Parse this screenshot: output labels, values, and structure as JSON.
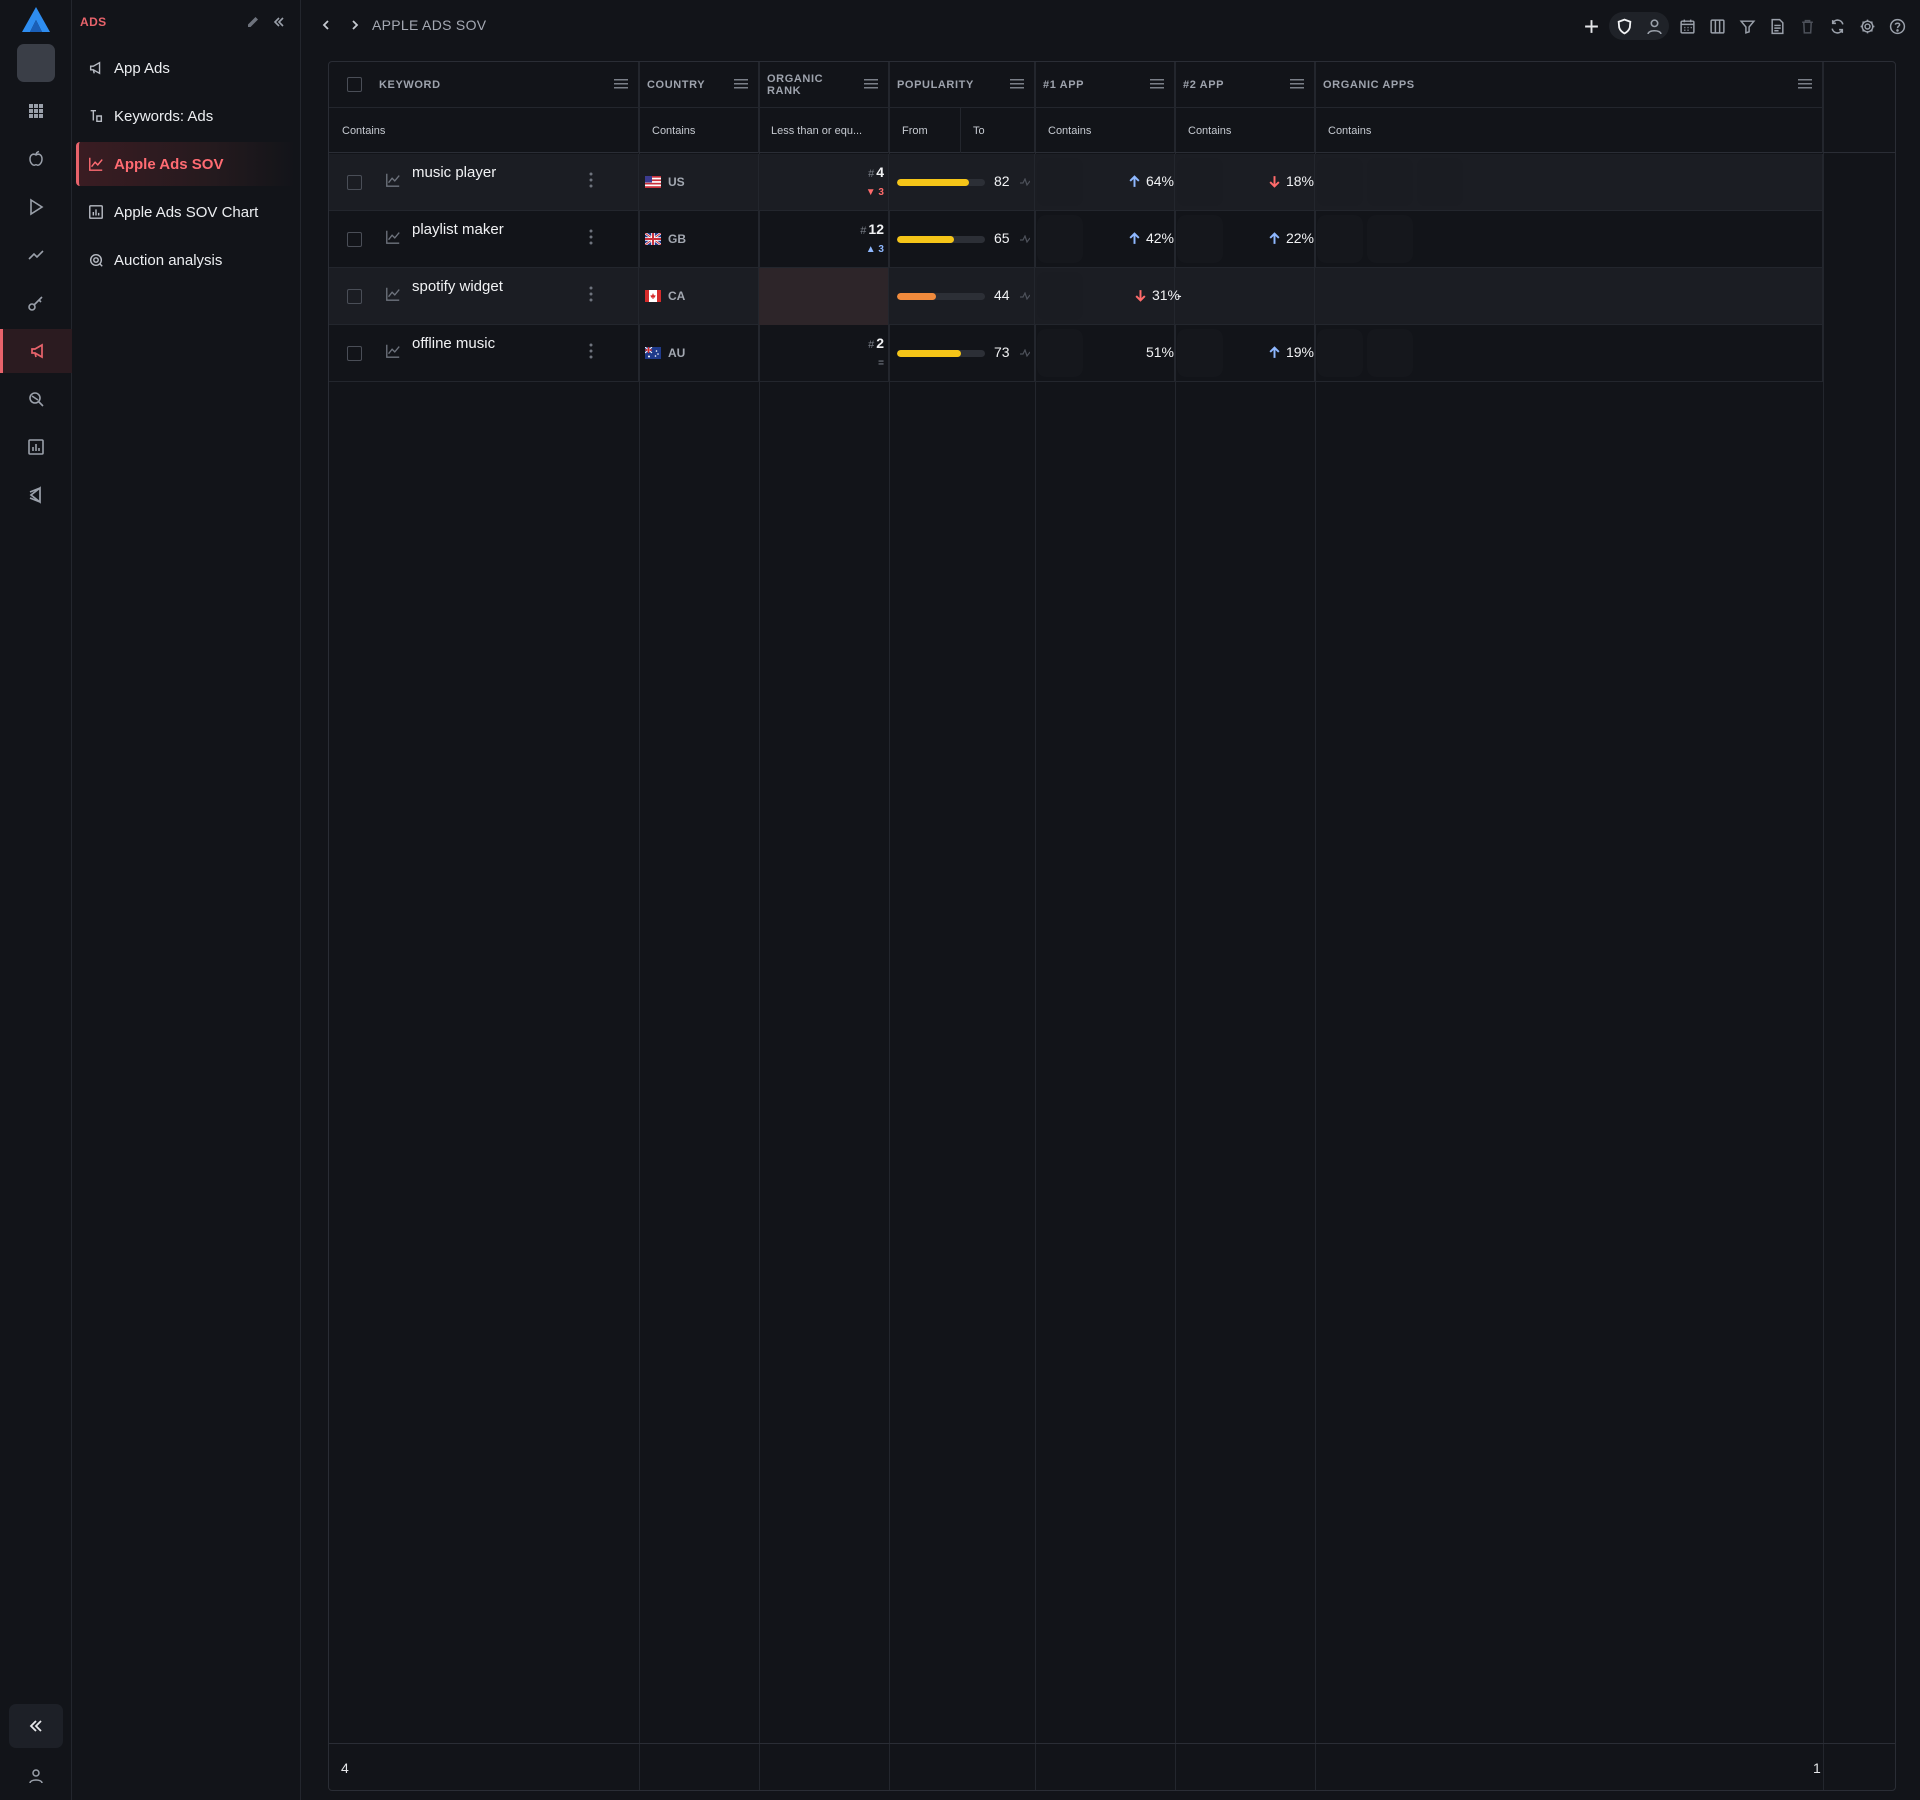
{
  "sidebar": {
    "title": "ADS",
    "items": [
      {
        "label": "App Ads",
        "icon": "megaphone-icon"
      },
      {
        "label": "Keywords: Ads",
        "icon": "keyword-ads-icon"
      },
      {
        "label": "Apple Ads SOV",
        "icon": "line-chart-icon",
        "active": true
      },
      {
        "label": "Apple Ads SOV Chart",
        "icon": "bar-chart-icon"
      },
      {
        "label": "Auction analysis",
        "icon": "auction-icon"
      }
    ]
  },
  "breadcrumb": "APPLE ADS SOV",
  "columns": {
    "keyword": "KEYWORD",
    "country": "COUNTRY",
    "organic_rank": "ORGANIC RANK",
    "popularity": "POPULARITY",
    "app1": "#1 APP",
    "app2": "#2 APP",
    "organic_apps": "ORGANIC APPS"
  },
  "filters": {
    "keyword": "Contains",
    "country": "Contains",
    "organic_rank": "Less than or equ...",
    "popularity_from": "From",
    "popularity_to": "To",
    "app1": "Contains",
    "app2": "Contains",
    "organic_apps": "Contains"
  },
  "rows": [
    {
      "keyword": "music player",
      "country": "US",
      "rank_hash": "#",
      "rank": "4",
      "rank_delta": "▼ 3",
      "popularity": 82,
      "popularity_label": "82",
      "app1_pct": "64%",
      "app2_pct": "18%"
    },
    {
      "keyword": "playlist maker",
      "country": "GB",
      "rank_hash": "#",
      "rank": "12",
      "rank_delta": "▲ 3",
      "popularity": 65,
      "popularity_label": "65",
      "app1_pct": "42%",
      "app2_pct": "22%"
    },
    {
      "keyword": "spotify widget",
      "country": "CA",
      "rank_hash": "",
      "rank": "",
      "rank_delta": "",
      "popularity": 44,
      "popularity_label": "44",
      "app1_pct": "31%",
      "app2_pct": "-"
    },
    {
      "keyword": "offline music",
      "country": "AU",
      "rank_hash": "#",
      "rank": "2",
      "rank_delta": "=",
      "popularity": 73,
      "popularity_label": "73",
      "app1_pct": "51%",
      "app2_pct": "19%"
    }
  ],
  "footer": {
    "count": "4",
    "right": "1"
  },
  "colors": {
    "accent": "#e8636b",
    "pop_high": "#f5c518",
    "pop_mid": "#f08a3c",
    "up": "#8fb8ff",
    "down": "#ff6b6b"
  }
}
